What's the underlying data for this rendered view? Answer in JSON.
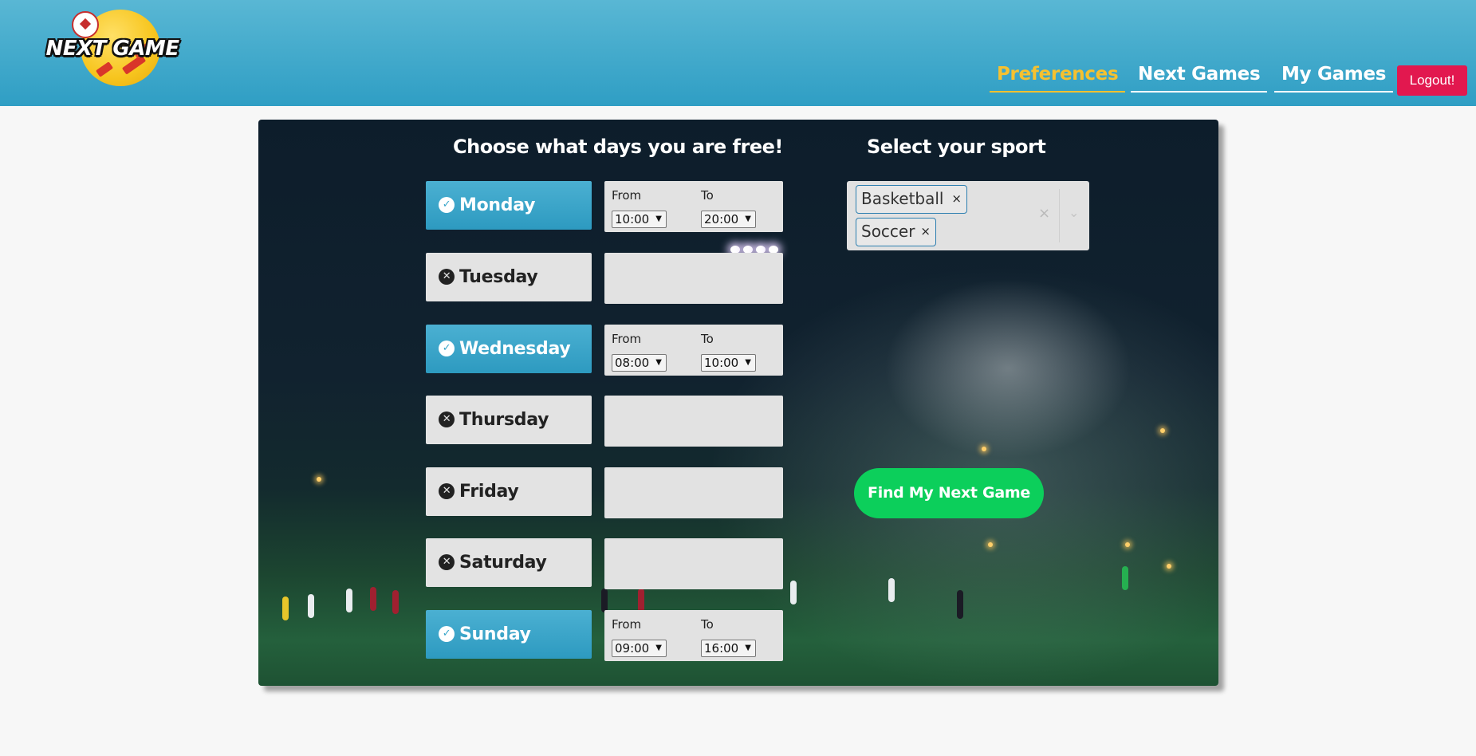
{
  "brand": {
    "logo_text": "NEXT GAME"
  },
  "nav": {
    "items": [
      {
        "label": "Preferences",
        "active": true
      },
      {
        "label": "Next Games",
        "active": false
      },
      {
        "label": "My Games",
        "active": false
      }
    ],
    "logout_label": "Logout!"
  },
  "days_section": {
    "title": "Choose what days you are free!",
    "from_label": "From",
    "to_label": "To",
    "days": [
      {
        "name": "Monday",
        "selected": true,
        "from": "10:00",
        "to": "20:00",
        "icon": "check-circle-icon"
      },
      {
        "name": "Tuesday",
        "selected": false,
        "icon": "x-circle-icon"
      },
      {
        "name": "Wednesday",
        "selected": true,
        "from": "08:00",
        "to": "10:00",
        "icon": "check-circle-icon"
      },
      {
        "name": "Thursday",
        "selected": false,
        "icon": "x-circle-icon"
      },
      {
        "name": "Friday",
        "selected": false,
        "icon": "x-circle-icon"
      },
      {
        "name": "Saturday",
        "selected": false,
        "icon": "x-circle-icon"
      },
      {
        "name": "Sunday",
        "selected": true,
        "from": "09:00",
        "to": "16:00",
        "icon": "check-circle-icon"
      }
    ]
  },
  "sport_section": {
    "title": "Select your sport",
    "selected": [
      "Basketball",
      "Soccer"
    ],
    "remove_glyph": "×",
    "clear_glyph": "×",
    "dropdown_glyph": "⌄"
  },
  "find_button_label": "Find My Next Game",
  "colors": {
    "header": "#2f9ec4",
    "active_nav": "#f6c12f",
    "logout": "#e2184f",
    "day_on": "#3aa6ca",
    "day_off": "#e3e3e3",
    "find_button": "#0ccf5b"
  }
}
